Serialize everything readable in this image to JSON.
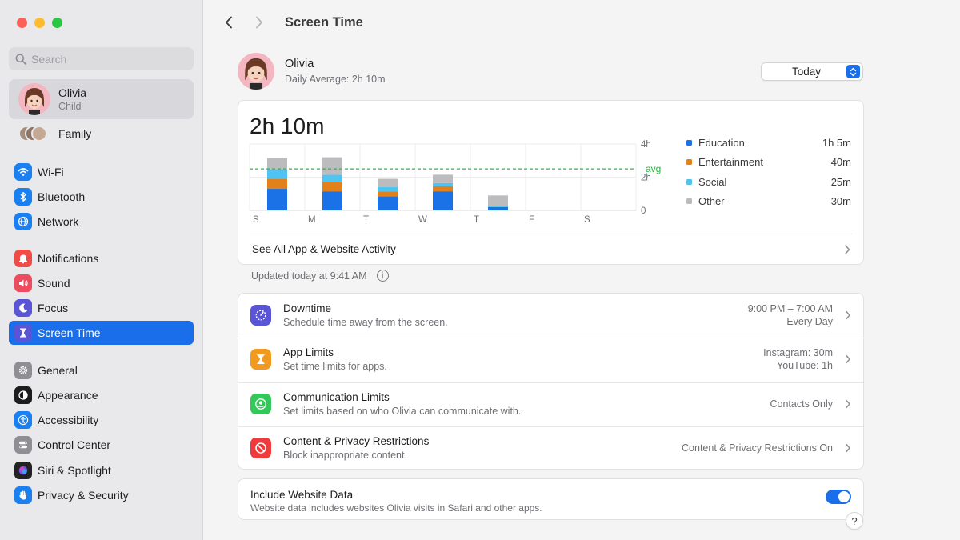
{
  "colors": {
    "accent": "#1a6eea",
    "education": "#1a72e6",
    "entertainment": "#e2811b",
    "social": "#4fc3f1",
    "other": "#bcbcbe",
    "avg_line": "#2fb544"
  },
  "sidebar": {
    "search_placeholder": "Search",
    "profile": {
      "name": "Olivia",
      "role": "Child"
    },
    "family_label": "Family",
    "items": [
      {
        "label": "Wi-Fi",
        "icon": "wifi-icon",
        "color": "#1a80f2"
      },
      {
        "label": "Bluetooth",
        "icon": "bluetooth-icon",
        "color": "#1a80f2"
      },
      {
        "label": "Network",
        "icon": "globe-icon",
        "color": "#1a80f2"
      },
      {
        "label": "Notifications",
        "icon": "bell-icon",
        "color": "#ef4b47"
      },
      {
        "label": "Sound",
        "icon": "speaker-icon",
        "color": "#ef4b5f"
      },
      {
        "label": "Focus",
        "icon": "moon-icon",
        "color": "#5a55d6"
      },
      {
        "label": "Screen Time",
        "icon": "hourglass-icon",
        "color": "#5a55d6"
      },
      {
        "label": "General",
        "icon": "gear-icon",
        "color": "#8e8e93"
      },
      {
        "label": "Appearance",
        "icon": "appearance-icon",
        "color": "#1d1d1f"
      },
      {
        "label": "Accessibility",
        "icon": "accessibility-icon",
        "color": "#1a80f2"
      },
      {
        "label": "Control Center",
        "icon": "toggles-icon",
        "color": "#8e8e93"
      },
      {
        "label": "Siri & Spotlight",
        "icon": "siri-icon",
        "color": "#222"
      },
      {
        "label": "Privacy & Security",
        "icon": "hand-icon",
        "color": "#1a80f2"
      }
    ]
  },
  "header": {
    "title": "Screen Time"
  },
  "user": {
    "name": "Olivia",
    "daily_average": "Daily Average: 2h 10m"
  },
  "period_select": {
    "value": "Today"
  },
  "summary": {
    "total": "2h 10m",
    "see_all": "See All App & Website Activity",
    "updated": "Updated today at 9:41 AM"
  },
  "chart_data": {
    "type": "bar",
    "stacked": true,
    "categories": [
      "S",
      "M",
      "T",
      "W",
      "T",
      "F",
      "S"
    ],
    "y_ticks": [
      "4h",
      "2h",
      "0"
    ],
    "ylim": [
      0,
      4
    ],
    "average_label": "avg",
    "average": 2.5,
    "grid": true,
    "legend_position": "right",
    "series": [
      {
        "name": "Education",
        "total": "1h 5m",
        "values": [
          1.3,
          1.15,
          0.85,
          1.15,
          0.2,
          0,
          0
        ]
      },
      {
        "name": "Entertainment",
        "total": "40m",
        "values": [
          0.6,
          0.55,
          0.3,
          0.3,
          0,
          0,
          0
        ]
      },
      {
        "name": "Social",
        "total": "25m",
        "values": [
          0.55,
          0.45,
          0.25,
          0.2,
          0.05,
          0,
          0
        ]
      },
      {
        "name": "Other",
        "total": "30m",
        "values": [
          0.7,
          1.05,
          0.5,
          0.5,
          0.65,
          0,
          0
        ]
      }
    ]
  },
  "settings": [
    {
      "title": "Downtime",
      "subtitle": "Schedule time away from the screen.",
      "value_lines": [
        "9:00 PM – 7:00 AM",
        "Every Day"
      ],
      "icon": "downtime-icon",
      "color": "#5a55d6"
    },
    {
      "title": "App Limits",
      "subtitle": "Set time limits for apps.",
      "value_lines": [
        "Instagram: 30m",
        "YouTube: 1h"
      ],
      "icon": "hourglass-icon",
      "color": "#f29a1f"
    },
    {
      "title": "Communication Limits",
      "subtitle": "Set limits based on who Olivia can communicate with.",
      "value_lines": [
        "Contacts Only"
      ],
      "icon": "person-circle-icon",
      "color": "#34c759"
    },
    {
      "title": "Content & Privacy Restrictions",
      "subtitle": "Block inappropriate content.",
      "value_lines": [
        "Content & Privacy Restrictions On"
      ],
      "icon": "no-entry-icon",
      "color": "#ef3b3b"
    }
  ],
  "website_data": {
    "title": "Include Website Data",
    "subtitle": "Website data includes websites Olivia visits in Safari and other apps.",
    "enabled": true
  },
  "help_label": "?"
}
